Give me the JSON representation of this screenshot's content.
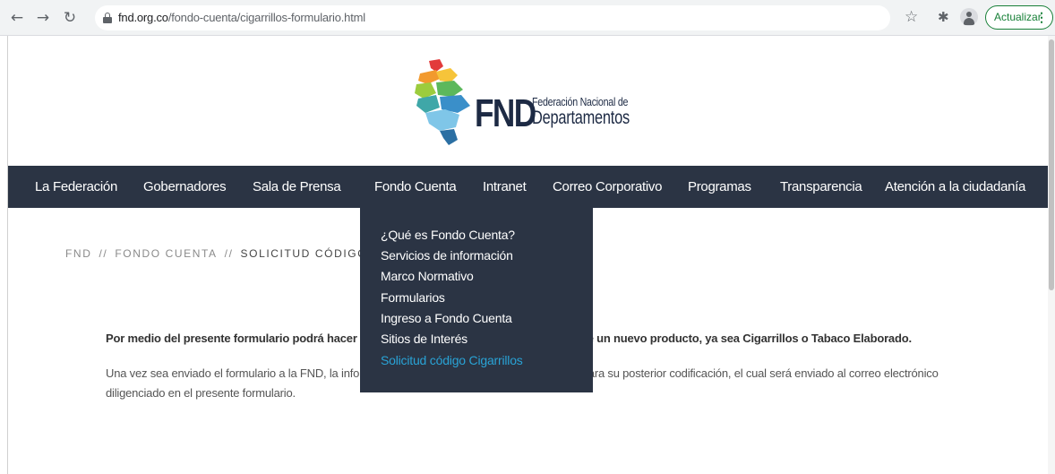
{
  "browser": {
    "url_host": "fnd.org.co",
    "url_path": "/fondo-cuenta/cigarrillos-formulario.html",
    "update_label": "Actualizar",
    "menu_dots": "⋮",
    "nav_icons": [
      "back-arrow-icon",
      "forward-arrow-icon",
      "reload-icon",
      "lock-icon",
      "star-icon",
      "puzzle-icon",
      "profile-icon"
    ]
  },
  "logo": {
    "acronym": "FND",
    "line1": "Federación Nacional de",
    "line2": "Departamentos"
  },
  "nav": {
    "items": [
      "La Federación",
      "Gobernadores",
      "Sala de Prensa",
      "Fondo Cuenta",
      "Intranet",
      "Correo Corporativo",
      "Programas",
      "Transparencia",
      "Atención a la ciudadanía"
    ]
  },
  "dropdown": {
    "items": [
      "¿Qué es Fondo Cuenta?",
      "Servicios de información",
      "Marco Normativo",
      "Formularios",
      "Ingreso a Fondo Cuenta",
      "Sitios de Interés",
      "Solicitud código Cigarrillos"
    ],
    "active_index": 6
  },
  "breadcrumb": {
    "items": [
      "FND",
      "FONDO CUENTA",
      "SOLICITUD CÓDIGO CIGARRILLOS"
    ],
    "separator": "//"
  },
  "content": {
    "lead": "Por medio del presente formulario podrá hacer la solicitud de creación del código único de un nuevo producto, ya sea Cigarrillos o Tabaco Elaborado.",
    "body": "Una vez sea enviado el formulario a la FND, la información del producto será remitida al DANE para su posterior codificación, el cual será enviado al correo electrónico diligenciado en el presente formulario."
  },
  "colors": {
    "nav_bg": "#2b3444",
    "active_link": "#29a3d6",
    "update_green": "#188038"
  }
}
